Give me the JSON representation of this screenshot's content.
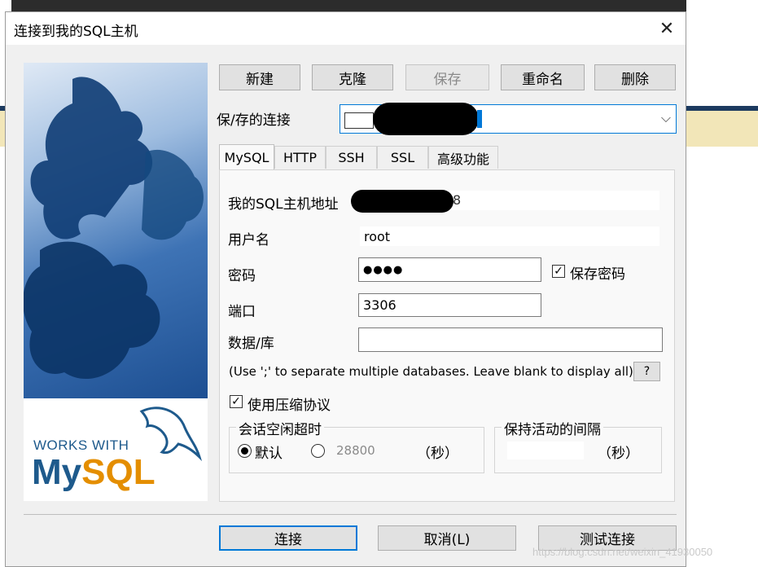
{
  "window": {
    "title": "连接到我的SQL主机"
  },
  "toolbar": {
    "new": "新建",
    "clone": "克隆",
    "save": "保存",
    "rename": "重命名",
    "delete": "删除"
  },
  "saved_conn": {
    "label": "保/存的连接",
    "selected_suffix": ""
  },
  "tabs": [
    "MySQL",
    "HTTP",
    "SSH",
    "SSL",
    "高级功能"
  ],
  "form": {
    "host_label": "我的SQL主机地址",
    "host_visible_suffix": "8",
    "user_label": "用户名",
    "user_value": "root",
    "password_label": "密码",
    "password_value": "●●●●",
    "save_password_label": "保存密码",
    "port_label": "端口",
    "port_value": "3306",
    "database_label": "数据/库",
    "database_value": "",
    "hint": "(Use ';' to separate multiple databases. Leave blank to display all)",
    "help": "?",
    "compress_label": "使用压缩协议"
  },
  "session_timeout": {
    "title": "会话空闲超时",
    "default_label": "默认",
    "custom_value": "28800",
    "unit": "（秒）"
  },
  "keepalive": {
    "title": "保持活动的间隔",
    "value": "",
    "unit": "（秒）"
  },
  "footer": {
    "connect": "连接",
    "cancel": "取消(L)",
    "test": "测试连接"
  },
  "branding": {
    "works_with": "WORKS WITH",
    "my": "My",
    "sql": "SQL"
  },
  "watermark": "https://blog.csdn.net/weixin_41930050",
  "colors": {
    "accent": "#0078d7",
    "mysql_blue": "#1e5a8c",
    "mysql_orange": "#e48e00"
  }
}
